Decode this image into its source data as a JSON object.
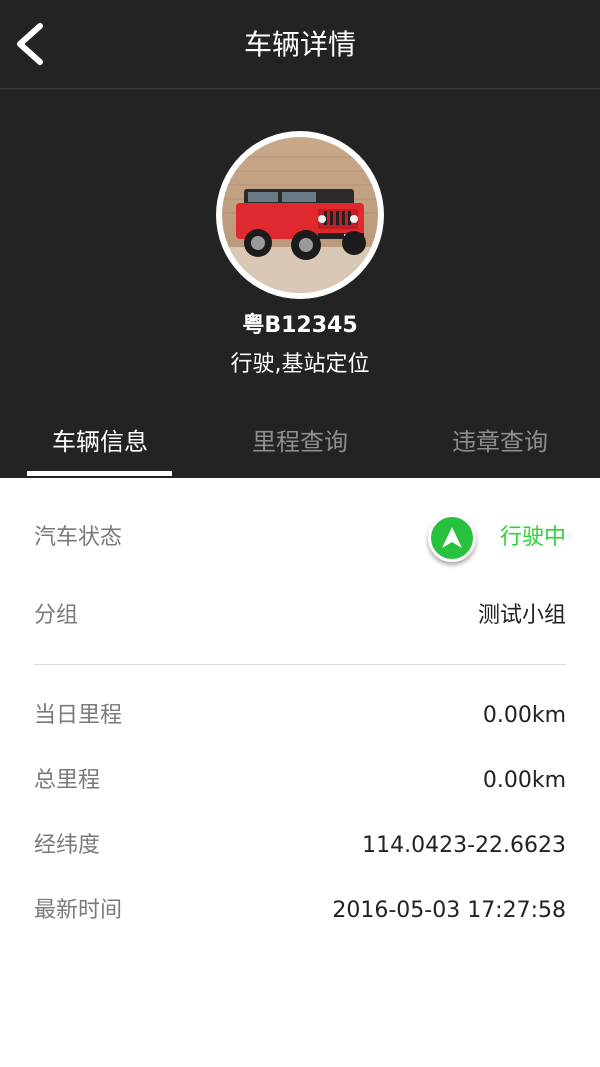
{
  "header": {
    "title": "车辆详情",
    "back_icon": "chevron-left-icon"
  },
  "vehicle": {
    "plate": "粤B12345",
    "location_status": "行驶,基站定位"
  },
  "tabs": [
    {
      "label": "车辆信息",
      "active": true
    },
    {
      "label": "里程查询",
      "active": false
    },
    {
      "label": "违章查询",
      "active": false
    }
  ],
  "info": {
    "status": {
      "label": "汽车状态",
      "value": "行驶中",
      "icon": "navigation-arrow-icon",
      "color": "#2ed239"
    },
    "group": {
      "label": "分组",
      "value": "测试小组"
    },
    "daily_mileage": {
      "label": "当日里程",
      "value": "0.00km"
    },
    "total_mileage": {
      "label": "总里程",
      "value": "0.00km"
    },
    "coordinates": {
      "label": "经纬度",
      "value": "114.0423-22.6623"
    },
    "latest_time": {
      "label": "最新时间",
      "value": "2016-05-03 17:27:58"
    }
  },
  "colors": {
    "header_bg": "#232323",
    "accent_green": "#2ed239",
    "tab_inactive": "#8e8e8e"
  }
}
